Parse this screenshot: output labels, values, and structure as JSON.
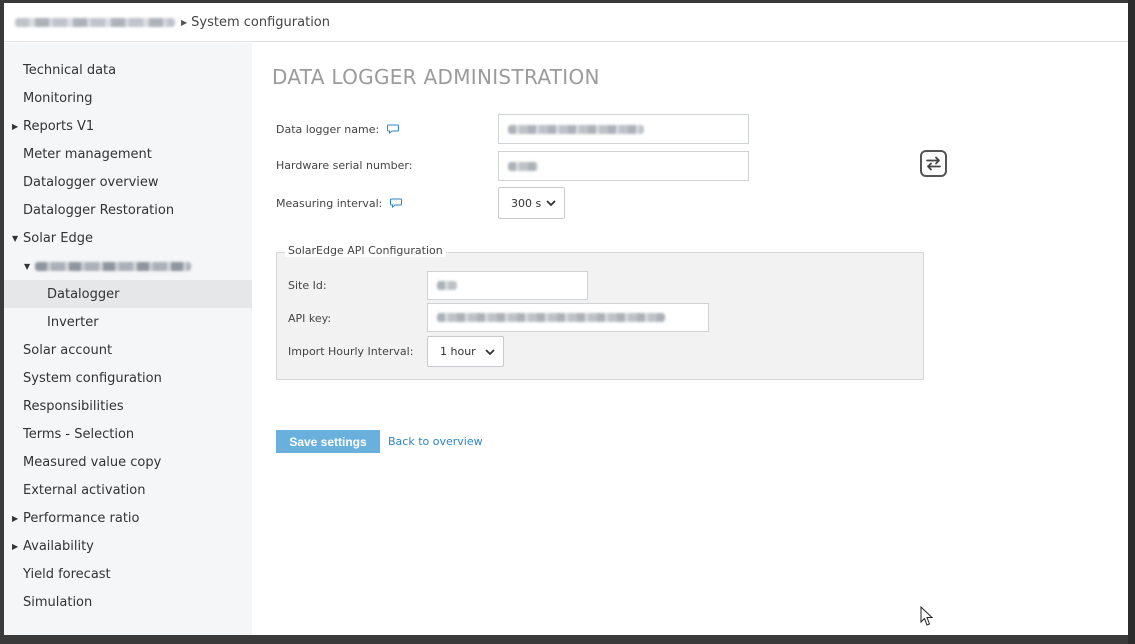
{
  "breadcrumb": {
    "parent_blurred": "Lolcaveo Refait Aeral 2 East",
    "current": "System configuration"
  },
  "sidebar": {
    "items": [
      {
        "label": "Technical data",
        "arrow": ""
      },
      {
        "label": "Monitoring",
        "arrow": ""
      },
      {
        "label": "Reports V1",
        "arrow": "▶"
      },
      {
        "label": "Meter management",
        "arrow": ""
      },
      {
        "label": "Datalogger overview",
        "arrow": ""
      },
      {
        "label": "Datalogger Restoration",
        "arrow": ""
      },
      {
        "label": "Solar Edge",
        "arrow": "▼"
      },
      {
        "label": "Lolcaveo Refait Aeral 2 East",
        "arrow": "▼"
      },
      {
        "label": "Datalogger",
        "arrow": ""
      },
      {
        "label": "Inverter",
        "arrow": ""
      },
      {
        "label": "Solar account",
        "arrow": ""
      },
      {
        "label": "System configuration",
        "arrow": ""
      },
      {
        "label": "Responsibilities",
        "arrow": ""
      },
      {
        "label": "Terms - Selection",
        "arrow": ""
      },
      {
        "label": "Measured value copy",
        "arrow": ""
      },
      {
        "label": "External activation",
        "arrow": ""
      },
      {
        "label": "Performance ratio",
        "arrow": "▶"
      },
      {
        "label": "Availability",
        "arrow": "▶"
      },
      {
        "label": "Yield forecast",
        "arrow": ""
      },
      {
        "label": "Simulation",
        "arrow": ""
      }
    ]
  },
  "main": {
    "title": "DATA LOGGER ADMINISTRATION",
    "fields": {
      "datalogger_name_label": "Data logger name:",
      "hardware_serial_label": "Hardware serial number:",
      "measuring_interval_label": "Measuring interval:",
      "measuring_interval_value": "300 s"
    },
    "api_config": {
      "legend": "SolarEdge API Configuration",
      "site_id_label": "Site Id:",
      "api_key_label": "API key:",
      "import_interval_label": "Import Hourly Interval:",
      "import_interval_value": "1 hour"
    },
    "actions": {
      "save_label": "Save settings",
      "back_label": "Back to overview"
    }
  },
  "colors": {
    "accent_blue": "#6ab0dc",
    "link_blue": "#2a86c8",
    "sidebar_bg": "#f4f6f7",
    "title_gray": "#9b9b9b"
  },
  "icons": {
    "comment": "comment-icon",
    "swap": "swap-arrows-icon",
    "chevron": "chevron-down-icon"
  }
}
